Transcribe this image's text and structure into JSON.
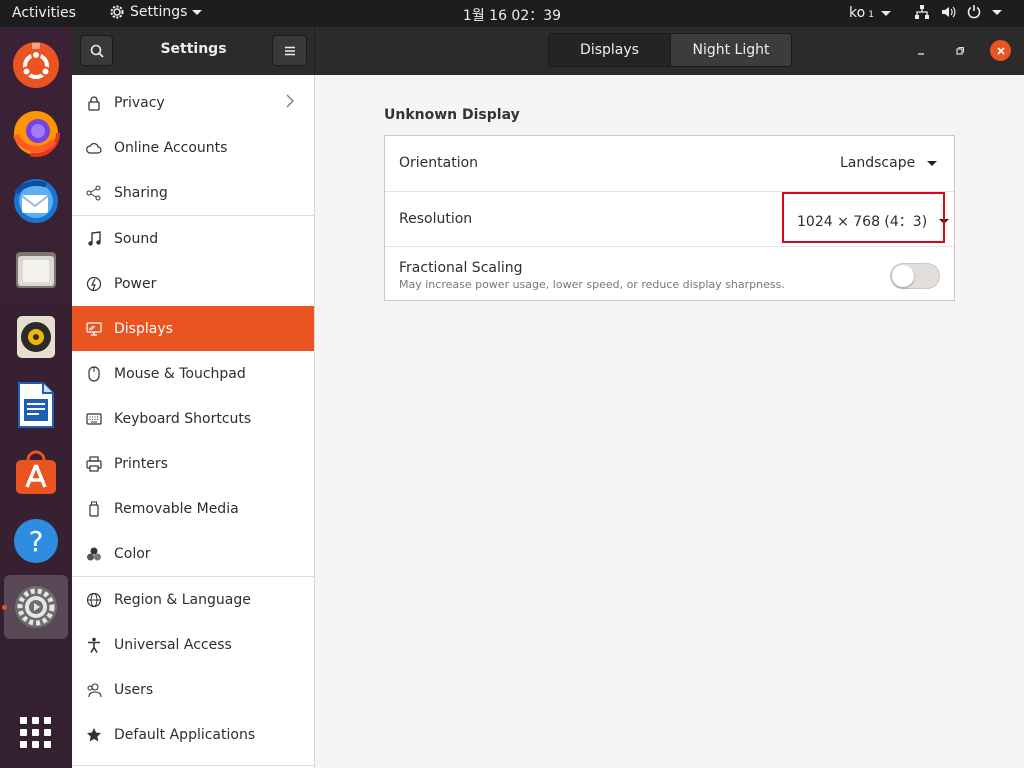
{
  "topbar": {
    "activities": "Activities",
    "app_name": "Settings",
    "clock": "1월 16  02：39",
    "input_lang": "ko",
    "input_lang_sub": "1"
  },
  "dock": {
    "items": [
      "ubuntu-software-icon",
      "firefox-icon",
      "thunderbird-icon",
      "files-icon",
      "rhythmbox-icon",
      "libreoffice-writer-icon",
      "software-center-icon",
      "help-icon",
      "settings-icon"
    ],
    "active": "settings-icon"
  },
  "sidebar": {
    "title": "Settings",
    "items": [
      {
        "label": "Privacy",
        "icon": "lock-icon",
        "has_submenu": true
      },
      {
        "label": "Online Accounts",
        "icon": "cloud-icon"
      },
      {
        "label": "Sharing",
        "icon": "share-icon"
      },
      {
        "label": "Sound",
        "icon": "music-note-icon"
      },
      {
        "label": "Power",
        "icon": "power-icon"
      },
      {
        "label": "Displays",
        "icon": "display-icon",
        "active": true
      },
      {
        "label": "Mouse & Touchpad",
        "icon": "mouse-icon"
      },
      {
        "label": "Keyboard Shortcuts",
        "icon": "keyboard-icon"
      },
      {
        "label": "Printers",
        "icon": "printer-icon"
      },
      {
        "label": "Removable Media",
        "icon": "usb-drive-icon"
      },
      {
        "label": "Color",
        "icon": "color-icon"
      },
      {
        "label": "Region & Language",
        "icon": "globe-icon"
      },
      {
        "label": "Universal Access",
        "icon": "accessibility-icon"
      },
      {
        "label": "Users",
        "icon": "users-icon"
      },
      {
        "label": "Default Applications",
        "icon": "star-icon"
      }
    ]
  },
  "header": {
    "tabs": [
      {
        "label": "Displays",
        "active": true
      },
      {
        "label": "Night Light",
        "active": false
      }
    ]
  },
  "display": {
    "section_title": "Unknown Display",
    "orientation_label": "Orientation",
    "orientation_value": "Landscape",
    "resolution_label": "Resolution",
    "resolution_value": "1024 × 768 (4：3)",
    "fractional_title": "Fractional Scaling",
    "fractional_subtitle": "May increase power usage, lower speed, or reduce display sharpness.",
    "fractional_enabled": false
  },
  "colors": {
    "accent": "#e95420",
    "highlight_box": "#e3001b"
  }
}
